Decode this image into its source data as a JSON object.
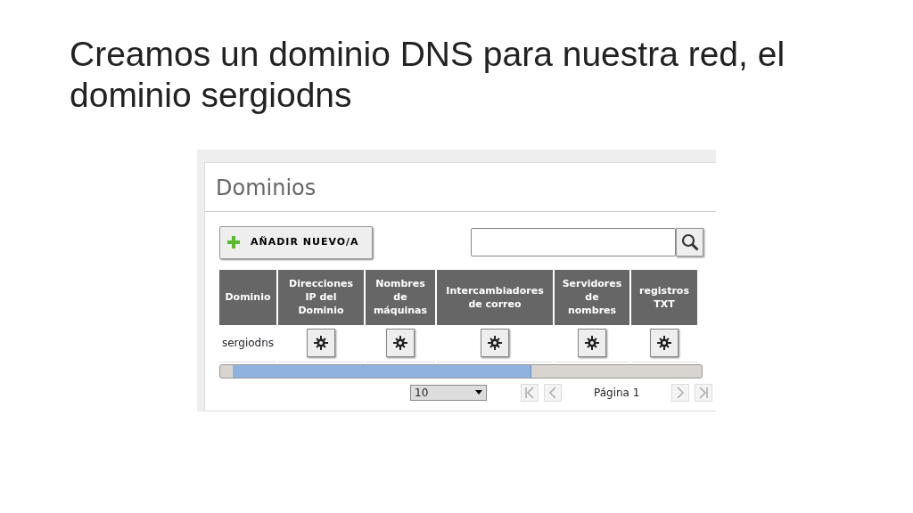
{
  "slide_title": "Creamos un dominio DNS para nuestra red, el dominio sergiodns",
  "panel": {
    "title": "Dominios",
    "add_button": "AÑADIR NUEVO/A",
    "table": {
      "columns": [
        "Dominio",
        "Direcciones\nIP del\nDominio",
        "Nombres\nde\nmáquinas",
        "Intercambiadores\nde correo",
        "Servidores\nde\nnombres",
        "registros\nTXT"
      ],
      "rows": [
        {
          "domain": "sergiodns"
        }
      ]
    },
    "pager": {
      "page_size": "10",
      "page_label": "Página 1"
    }
  }
}
